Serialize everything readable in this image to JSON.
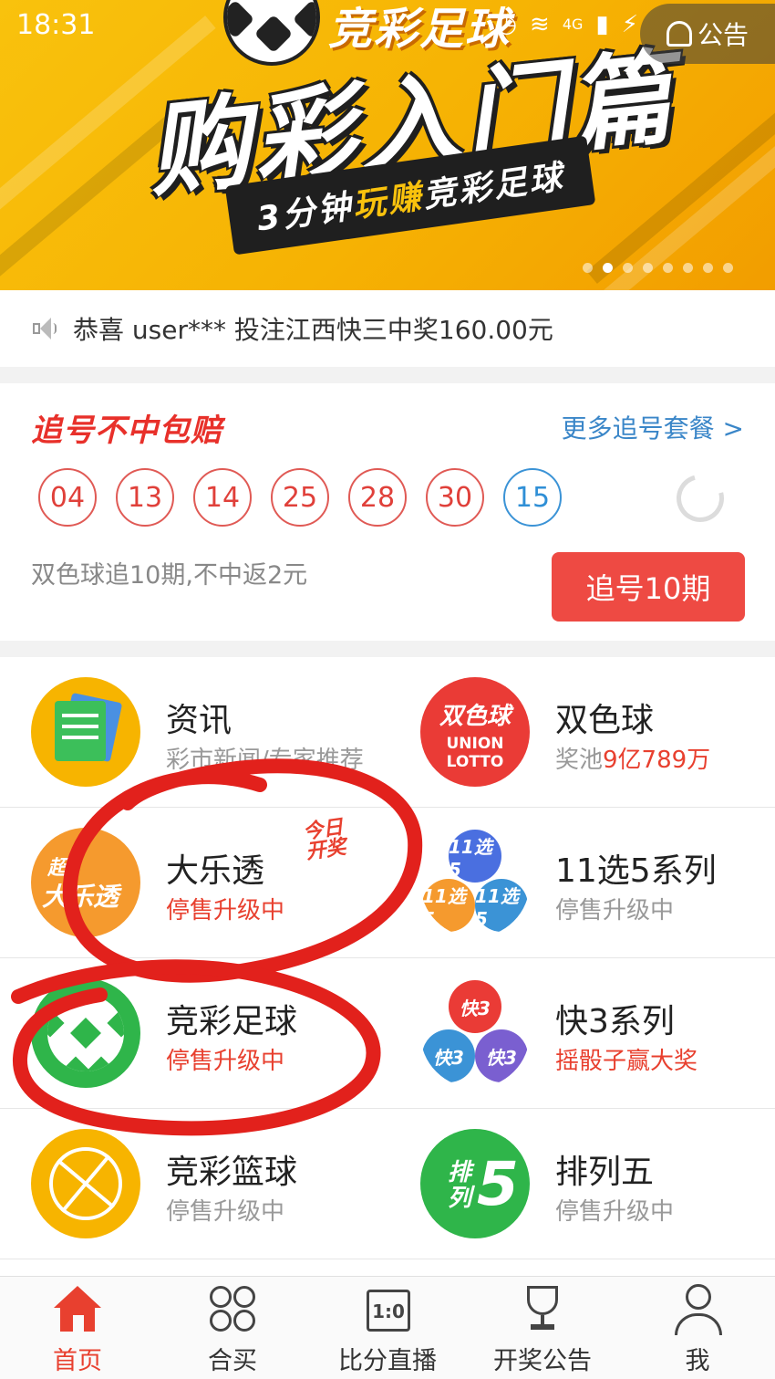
{
  "status_bar": {
    "time": "18:31",
    "network": "4G"
  },
  "banner": {
    "top_text": "竞彩足球",
    "title": "购彩入门篇",
    "ribbon_pre": "3分钟",
    "ribbon_hl": "玩赚",
    "ribbon_post": "竞彩足球",
    "announce_label": "公告",
    "slide_count": 8,
    "active_slide": 2
  },
  "notice": {
    "text": "恭喜 user*** 投注江西快三中奖160.00元"
  },
  "chase": {
    "title": "追号不中包赔",
    "more_link": "更多追号套餐 >",
    "red_balls": [
      "04",
      "13",
      "14",
      "25",
      "28",
      "30"
    ],
    "blue_ball": "15",
    "description": "双色球追10期,不中返2元",
    "button": "追号10期"
  },
  "games": [
    {
      "name": "资讯",
      "sub": "彩市新闻/专家推荐",
      "icon": "news-icon"
    },
    {
      "name": "双色球",
      "sub_pre": "奖池",
      "sub_hl": "9亿789万",
      "icon": "union-lotto-icon",
      "icon_text_1": "双色球",
      "icon_text_2": "UNION",
      "icon_text_3": "LOTTO"
    },
    {
      "name": "大乐透",
      "sub": "停售升级中",
      "icon": "dlt-icon",
      "icon_text_1": "超",
      "icon_text_2": "大乐透",
      "tag_1": "今日",
      "tag_2": "开奖"
    },
    {
      "name": "11选5系列",
      "sub": "停售升级中",
      "icon": "11x5-icon",
      "icon_text": "11选5"
    },
    {
      "name": "竞彩足球",
      "sub": "停售升级中",
      "icon": "soccer-icon"
    },
    {
      "name": "快3系列",
      "sub": "摇骰子赢大奖",
      "icon": "k3-icon",
      "icon_text": "快3"
    },
    {
      "name": "竞彩篮球",
      "sub": "停售升级中",
      "icon": "basketball-icon"
    },
    {
      "name": "排列五",
      "sub": "停售升级中",
      "icon": "plw-icon",
      "icon_text_1": "排",
      "icon_text_2": "列",
      "icon_text_3": "5"
    }
  ],
  "nav": [
    {
      "label": "首页",
      "icon": "home-icon",
      "active": true
    },
    {
      "label": "合买",
      "icon": "group-icon"
    },
    {
      "label": "比分直播",
      "icon": "calendar-icon",
      "icon_text": "1:0"
    },
    {
      "label": "开奖公告",
      "icon": "trophy-icon"
    },
    {
      "label": "我",
      "icon": "user-icon"
    }
  ],
  "colors": {
    "accent_red": "#e8402f",
    "link_blue": "#3a86c8",
    "banner_yellow": "#f9c20d",
    "annotation_red": "#e2211c"
  }
}
